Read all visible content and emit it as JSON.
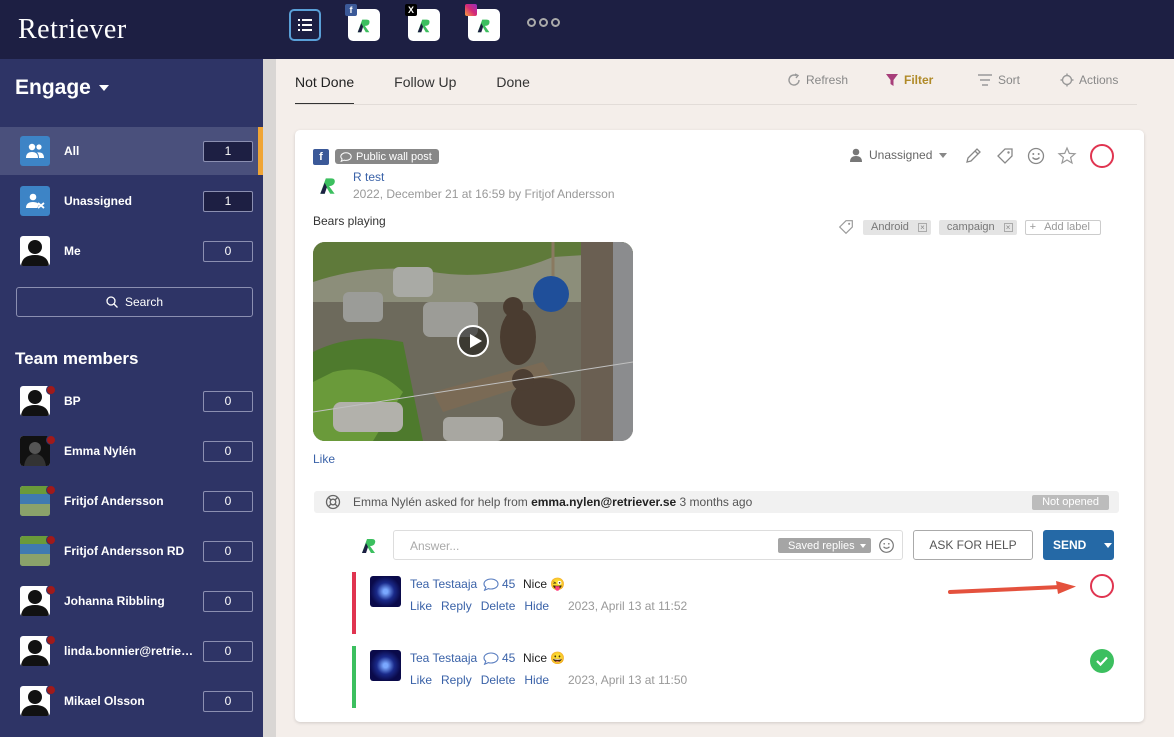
{
  "app": {
    "logo": "Retriever"
  },
  "colors": {
    "topbar": "#1d1f43",
    "sidebar": "#2e3466",
    "accent_orange": "#f0a535",
    "link": "#3a62a8",
    "not_done": "#e03450",
    "done": "#3cbf5f",
    "send": "#2569a6"
  },
  "topbar": {
    "icons": [
      {
        "name": "list-view-icon"
      },
      {
        "name": "facebook-channel-icon",
        "badge": "f"
      },
      {
        "name": "x-channel-icon",
        "badge": "X"
      },
      {
        "name": "instagram-channel-icon",
        "badge": ""
      },
      {
        "name": "more-icon"
      }
    ]
  },
  "sidebar": {
    "section_title": "Engage",
    "items": [
      {
        "label": "All",
        "count": "1",
        "active": true
      },
      {
        "label": "Unassigned",
        "count": "1"
      },
      {
        "label": "Me",
        "count": "0"
      }
    ],
    "search_label": "Search",
    "team_title": "Team members",
    "team": [
      {
        "label": "BP",
        "count": "0"
      },
      {
        "label": "Emma Nylén",
        "count": "0"
      },
      {
        "label": "Fritjof Andersson",
        "count": "0"
      },
      {
        "label": "Fritjof Andersson RD",
        "count": "0"
      },
      {
        "label": "Johanna Ribbling",
        "count": "0"
      },
      {
        "label": "linda.bonnier@retriever.se",
        "count": "0"
      },
      {
        "label": "Mikael Olsson",
        "count": "0"
      }
    ]
  },
  "main": {
    "tabs": [
      "Not Done",
      "Follow Up",
      "Done"
    ],
    "toolbar": {
      "refresh": "Refresh",
      "filter": "Filter",
      "sort": "Sort",
      "actions": "Actions"
    }
  },
  "post": {
    "network_badge": "f",
    "type": "Public wall post",
    "page_name": "R test",
    "meta": "2022, December 21 at 16:59 by Fritjof Andersson",
    "text": "Bears playing",
    "like": "Like",
    "assignee": "Unassigned",
    "labels": [
      "Android",
      "campaign"
    ],
    "add_label": "Add label"
  },
  "help": {
    "prefix": "Emma Nylén asked for help from ",
    "email": "emma.nylen@retriever.se",
    "suffix": " 3 months ago",
    "status": "Not opened"
  },
  "reply": {
    "placeholder": "Answer...",
    "saved_replies": "Saved replies",
    "ask_for_help": "ASK FOR HELP",
    "send": "SEND"
  },
  "comments": [
    {
      "author": "Tea Testaaja",
      "count": "45",
      "text": "Nice 😜",
      "actions": [
        "Like",
        "Reply",
        "Delete",
        "Hide"
      ],
      "time": "2023, April 13 at 11:52",
      "done": false
    },
    {
      "author": "Tea Testaaja",
      "count": "45",
      "text": "Nice 😀",
      "actions": [
        "Like",
        "Reply",
        "Delete",
        "Hide"
      ],
      "time": "2023, April 13 at 11:50",
      "done": true
    }
  ]
}
